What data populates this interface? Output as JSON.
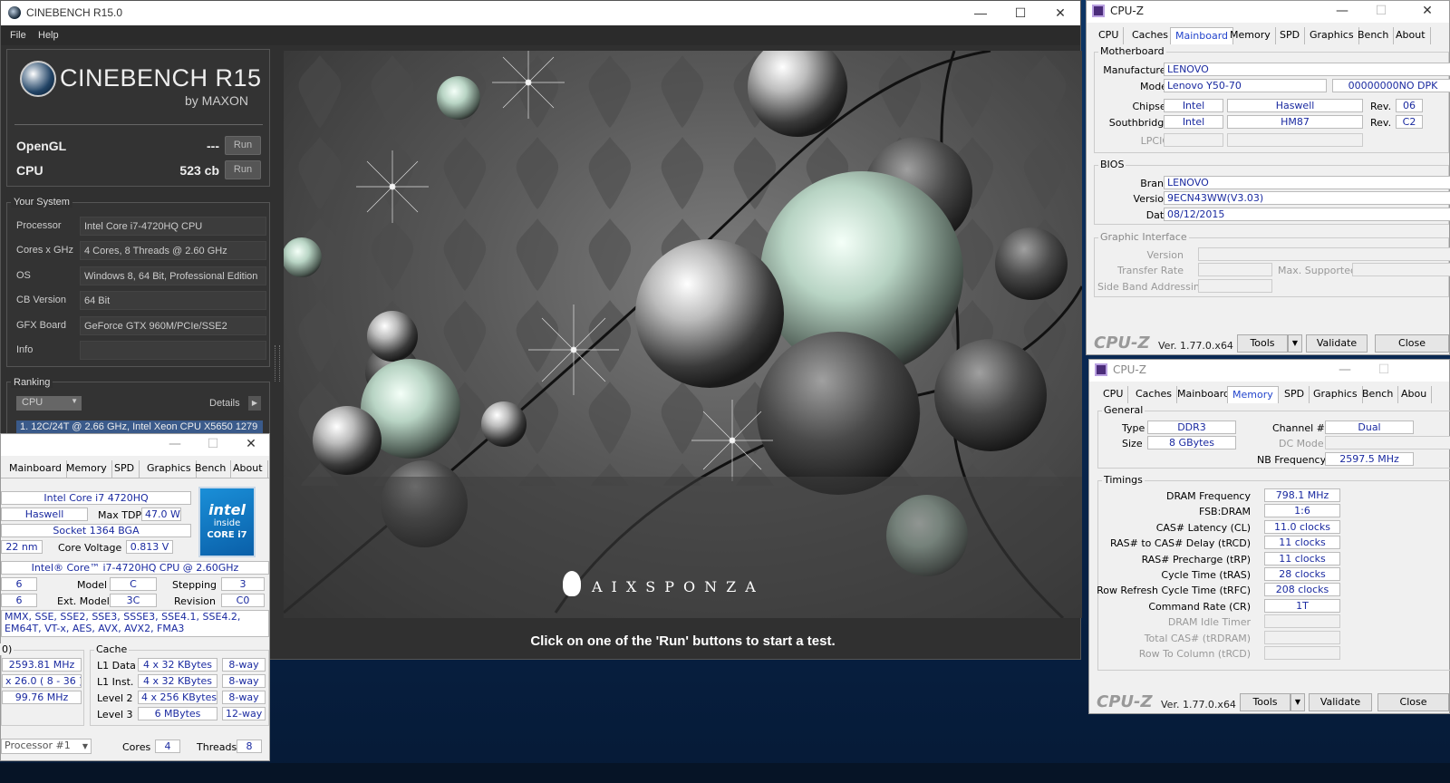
{
  "cinebench": {
    "title": "CINEBENCH R15.0",
    "menu": [
      "File",
      "Help"
    ],
    "logo_title": "CINEBENCH R15",
    "logo_sub": "by MAXON",
    "opengl": {
      "label": "OpenGL",
      "value": "---",
      "button": "Run"
    },
    "cpu": {
      "label": "CPU",
      "value": "523 cb",
      "button": "Run"
    },
    "your_system_title": "Your System",
    "system": [
      {
        "key": "Processor",
        "value": "Intel Core i7-4720HQ CPU"
      },
      {
        "key": "Cores x GHz",
        "value": "4 Cores, 8 Threads @ 2.60 GHz"
      },
      {
        "key": "OS",
        "value": "Windows 8, 64 Bit, Professional Edition"
      },
      {
        "key": "CB Version",
        "value": "64 Bit"
      },
      {
        "key": "GFX Board",
        "value": "GeForce GTX 960M/PCIe/SSE2"
      },
      {
        "key": "Info",
        "value": ""
      }
    ],
    "ranking_title": "Ranking",
    "ranking_select": "CPU",
    "ranking_details": "Details",
    "ranking_row": "1. 12C/24T @ 2.66 GHz, Intel Xeon CPU X5650     1279",
    "status": "Click on one of the 'Run' buttons to start a test.",
    "render_brand": "AIXSPONZA"
  },
  "cpuz_cpu": {
    "tabs": [
      "Mainboard",
      "Memory",
      "SPD",
      "Graphics",
      "Bench",
      "About"
    ],
    "name": "Intel Core i7 4720HQ",
    "codename": "Haswell",
    "max_tdp_label": "Max TDP",
    "max_tdp": "47.0 W",
    "package": "Socket 1364 BGA",
    "technology": "22 nm",
    "core_voltage_label": "Core Voltage",
    "core_voltage": "0.813 V",
    "specification": "Intel® Core™ i7-4720HQ CPU @ 2.60GHz",
    "family": "6",
    "model_label": "Model",
    "model": "C",
    "stepping_label": "Stepping",
    "stepping": "3",
    "ext_family": "6",
    "ext_model_label": "Ext. Model",
    "ext_model": "3C",
    "revision_label": "Revision",
    "revision": "C0",
    "instructions": "MMX, SSE, SSE2, SSE3, SSSE3, SSE4.1, SSE4.2, EM64T, VT-x, AES, AVX, AVX2, FMA3",
    "clocks_title": "0)",
    "core_speed": "2593.81 MHz",
    "multiplier": "x 26.0 ( 8 - 36 )",
    "bus_speed": "99.76 MHz",
    "cache_title": "Cache",
    "cache": [
      {
        "label": "L1 Data",
        "size": "4 x 32 KBytes",
        "way": "8-way"
      },
      {
        "label": "L1 Inst.",
        "size": "4 x 32 KBytes",
        "way": "8-way"
      },
      {
        "label": "Level 2",
        "size": "4 x 256 KBytes",
        "way": "8-way"
      },
      {
        "label": "Level 3",
        "size": "6 MBytes",
        "way": "12-way"
      }
    ],
    "processor_select": "Processor #1",
    "cores_label": "Cores",
    "cores": "4",
    "threads_label": "Threads",
    "threads": "8",
    "intel_badge": {
      "brand": "intel",
      "inside": "inside",
      "core": "CORE i7"
    }
  },
  "cpuz_mb": {
    "title": "CPU-Z",
    "tabs": [
      "CPU",
      "Caches",
      "Mainboard",
      "Memory",
      "SPD",
      "Graphics",
      "Bench",
      "About"
    ],
    "active_tab": "Mainboard",
    "motherboard_title": "Motherboard",
    "manufacturer_label": "Manufacturer",
    "manufacturer": "LENOVO",
    "model_label": "Model",
    "model": "Lenovo Y50-70",
    "model_rev": "00000000NO DPK",
    "chipset_label": "Chipset",
    "chipset_vendor": "Intel",
    "chipset_name": "Haswell",
    "rev_label": "Rev.",
    "chipset_rev": "06",
    "southbridge_label": "Southbridge",
    "sb_vendor": "Intel",
    "sb_name": "HM87",
    "sb_rev": "C2",
    "lpcio_label": "LPCIO",
    "bios_title": "BIOS",
    "brand_label": "Brand",
    "bios_brand": "LENOVO",
    "version_label": "Version",
    "bios_version": "9ECN43WW(V3.03)",
    "date_label": "Date",
    "bios_date": "08/12/2015",
    "gi_title": "Graphic Interface",
    "gi_version_label": "Version",
    "gi_transfer_label": "Transfer Rate",
    "gi_max_label": "Max. Supported",
    "gi_sba_label": "Side Band Addressing",
    "brand": "CPU-Z",
    "version": "Ver. 1.77.0.x64",
    "tools": "Tools",
    "validate": "Validate",
    "close": "Close"
  },
  "cpuz_mem": {
    "title": "CPU-Z",
    "tabs": [
      "CPU",
      "Caches",
      "Mainboard",
      "Memory",
      "SPD",
      "Graphics",
      "Bench",
      "Abou"
    ],
    "active_tab": "Memory",
    "general_title": "General",
    "type_label": "Type",
    "type": "DDR3",
    "size_label": "Size",
    "size": "8 GBytes",
    "channel_label": "Channel #",
    "channel": "Dual",
    "dc_label": "DC Mode",
    "nb_label": "NB Frequency",
    "nb": "2597.5 MHz",
    "timings_title": "Timings",
    "timings": [
      {
        "label": "DRAM Frequency",
        "value": "798.1 MHz",
        "dim": false
      },
      {
        "label": "FSB:DRAM",
        "value": "1:6",
        "dim": false
      },
      {
        "label": "CAS# Latency (CL)",
        "value": "11.0 clocks",
        "dim": false
      },
      {
        "label": "RAS# to CAS# Delay (tRCD)",
        "value": "11 clocks",
        "dim": false
      },
      {
        "label": "RAS# Precharge (tRP)",
        "value": "11 clocks",
        "dim": false
      },
      {
        "label": "Cycle Time (tRAS)",
        "value": "28 clocks",
        "dim": false
      },
      {
        "label": "Row Refresh Cycle Time (tRFC)",
        "value": "208 clocks",
        "dim": false
      },
      {
        "label": "Command Rate (CR)",
        "value": "1T",
        "dim": false
      },
      {
        "label": "DRAM Idle Timer",
        "value": "",
        "dim": true
      },
      {
        "label": "Total CAS# (tRDRAM)",
        "value": "",
        "dim": true
      },
      {
        "label": "Row To Column (tRCD)",
        "value": "",
        "dim": true
      }
    ],
    "brand": "CPU-Z",
    "version": "Ver. 1.77.0.x64",
    "tools": "Tools",
    "validate": "Validate",
    "close": "Close"
  }
}
